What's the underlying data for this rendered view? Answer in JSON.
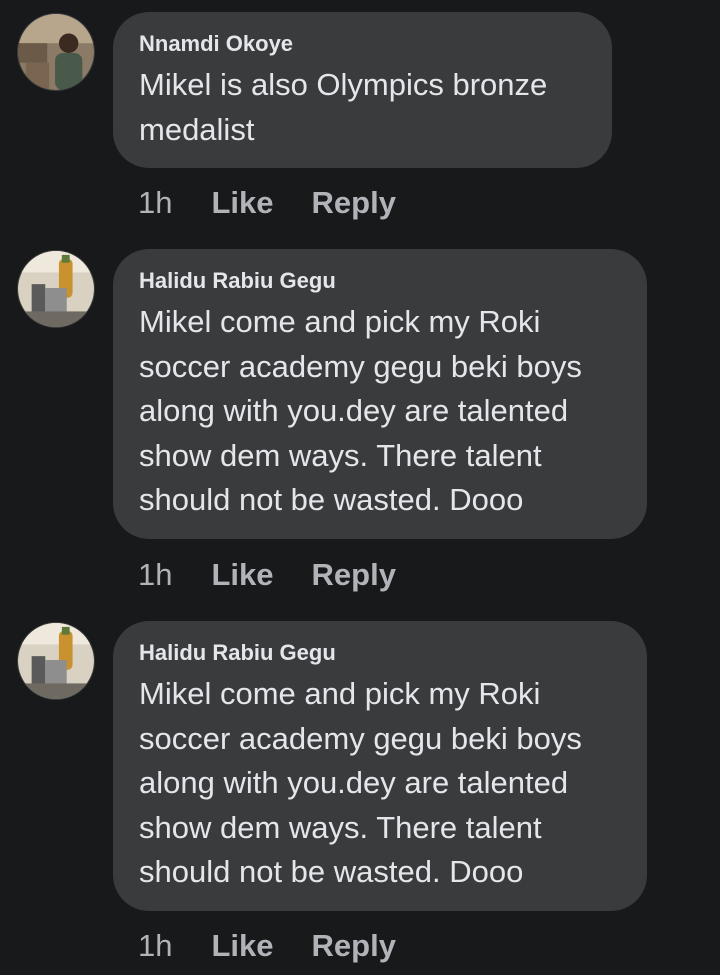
{
  "comments": [
    {
      "author": "Nnamdi Okoye",
      "lines": [
        "Mikel is also Olympics bronze",
        "medalist"
      ],
      "time": "1h",
      "like_label": "Like",
      "reply_label": "Reply"
    },
    {
      "author": "Halidu Rabiu Gegu",
      "lines": [
        "Mikel come and pick my Roki",
        "soccer academy gegu beki boys",
        "along with you.dey are talented",
        "show dem ways. There talent",
        "should not be wasted. Dooo"
      ],
      "time": "1h",
      "like_label": "Like",
      "reply_label": "Reply"
    },
    {
      "author": "Halidu Rabiu Gegu",
      "lines": [
        "Mikel come and pick my Roki",
        "soccer academy gegu beki boys",
        "along with you.dey are talented",
        "show dem ways. There talent",
        "should not be wasted. Dooo"
      ],
      "time": "1h",
      "like_label": "Like",
      "reply_label": "Reply"
    }
  ],
  "colors": {
    "background": "#18191a",
    "bubble": "#3a3b3c",
    "text_primary": "#e4e6eb",
    "text_secondary": "#b0b3b8"
  },
  "icons": {
    "avatar_1": "profile-photo-avatar",
    "avatar_2": "profile-photo-avatar",
    "avatar_3": "profile-photo-avatar"
  }
}
